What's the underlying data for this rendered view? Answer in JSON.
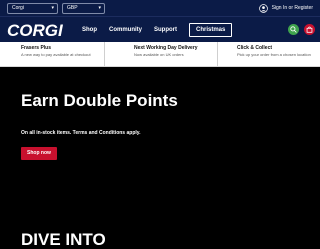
{
  "utility": {
    "region": "Corgi",
    "currency": "GBP",
    "signin": "Sign In or Register"
  },
  "nav": {
    "logo": "CORGI",
    "items": [
      "Shop",
      "Community",
      "Support"
    ],
    "christmas": "Christmas"
  },
  "usps": [
    {
      "title": "Frasers Plus",
      "sub": "A new way to pay available at checkout"
    },
    {
      "title": "Next Working Day Delivery",
      "sub": "Now available on UK orders"
    },
    {
      "title": "Click & Collect",
      "sub": "Pick up your order from a chosen location"
    }
  ],
  "hero": {
    "title": "Earn Double Points",
    "subtitle": "On all in-stock items. Terms and Conditions apply.",
    "button": "Shop now",
    "next_heading": "DIVE INTO"
  },
  "colors": {
    "navy": "#0b1b47",
    "red": "#c8102e",
    "green": "#3fa34d"
  }
}
